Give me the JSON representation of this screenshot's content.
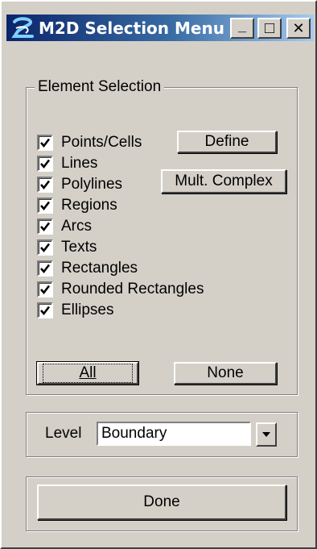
{
  "window": {
    "title": "M2D Selection Menu",
    "minimize_glyph": "_",
    "maximize_glyph": "□",
    "close_glyph": "✕"
  },
  "element_selection": {
    "legend": "Element Selection",
    "items": [
      {
        "label": "Points/Cells",
        "checked": true
      },
      {
        "label": "Lines",
        "checked": true
      },
      {
        "label": "Polylines",
        "checked": true
      },
      {
        "label": "Regions",
        "checked": true
      },
      {
        "label": "Arcs",
        "checked": true
      },
      {
        "label": "Texts",
        "checked": true
      },
      {
        "label": "Rectangles",
        "checked": true
      },
      {
        "label": "Rounded Rectangles",
        "checked": true
      },
      {
        "label": "Ellipses",
        "checked": true
      }
    ],
    "define_label": "Define",
    "mult_complex_label": "Mult. Complex",
    "all_label": "All",
    "none_label": "None"
  },
  "level": {
    "label": "Level",
    "value": "Boundary"
  },
  "done_label": "Done"
}
